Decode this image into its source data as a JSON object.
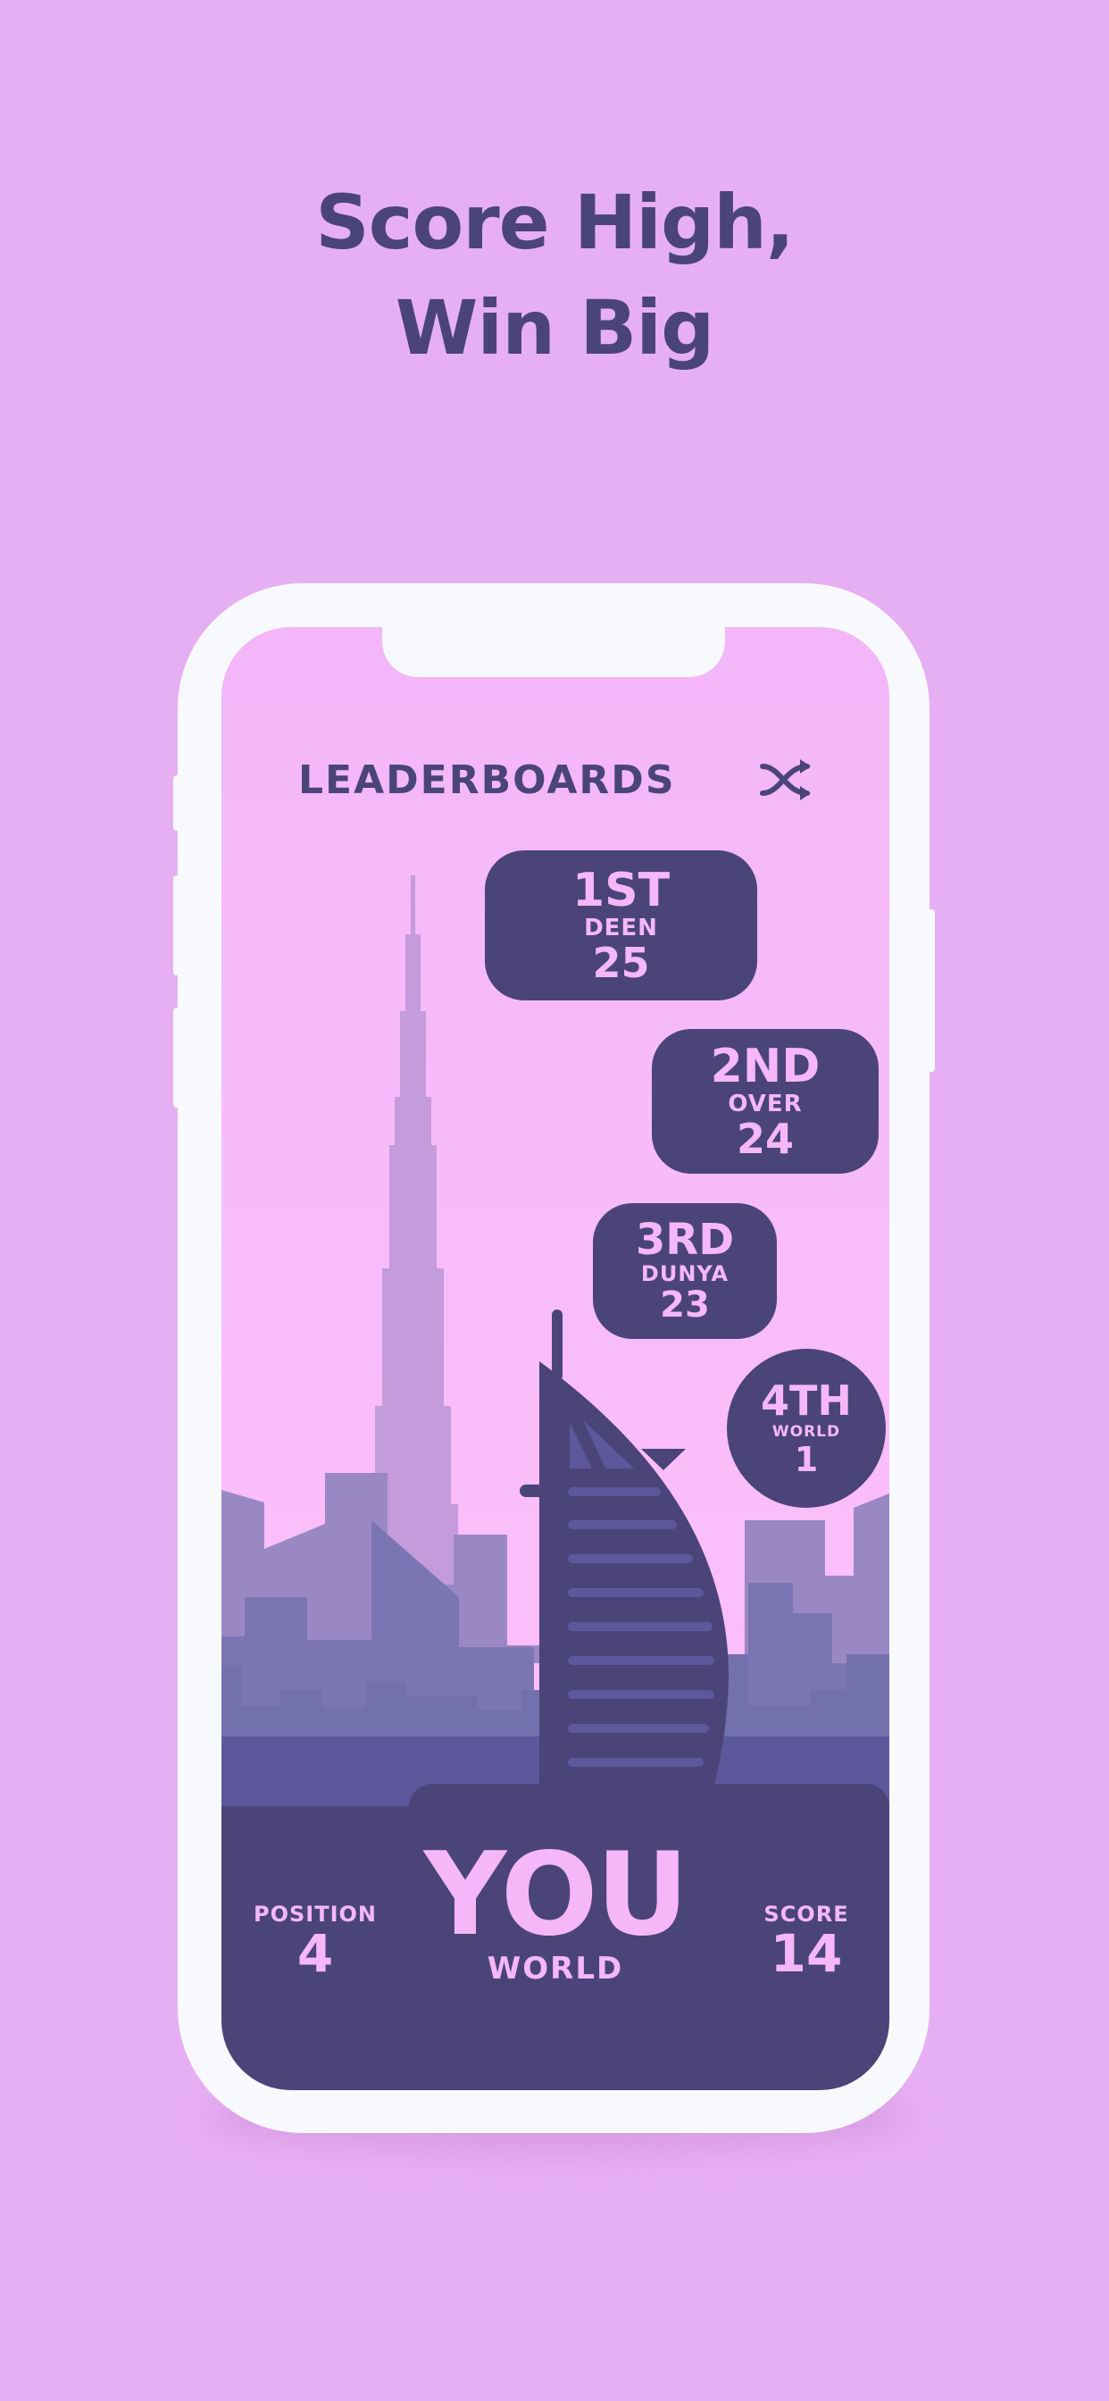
{
  "headline": {
    "line1": "Score High,",
    "line2": "Win Big"
  },
  "screen": {
    "title": "LEADERBOARDS",
    "close_icon": "shuffle-icon",
    "leaders": [
      {
        "rank": "1ST",
        "name": "DEEN",
        "score": "25"
      },
      {
        "rank": "2ND",
        "name": "OVER",
        "score": "24"
      },
      {
        "rank": "3RD",
        "name": "DUNYA",
        "score": "23"
      },
      {
        "rank": "4TH",
        "name": "WORLD",
        "score": "1"
      }
    ],
    "you": {
      "position_label": "POSITION",
      "position_value": "4",
      "title": "YOU",
      "subtitle": "WORLD",
      "score_label": "SCORE",
      "score_value": "14"
    }
  },
  "colors": {
    "background": "#e7aff3",
    "primary": "#4a4479",
    "accent_text": "#f5b7f8",
    "phone_frame": "#f8f9fd"
  }
}
